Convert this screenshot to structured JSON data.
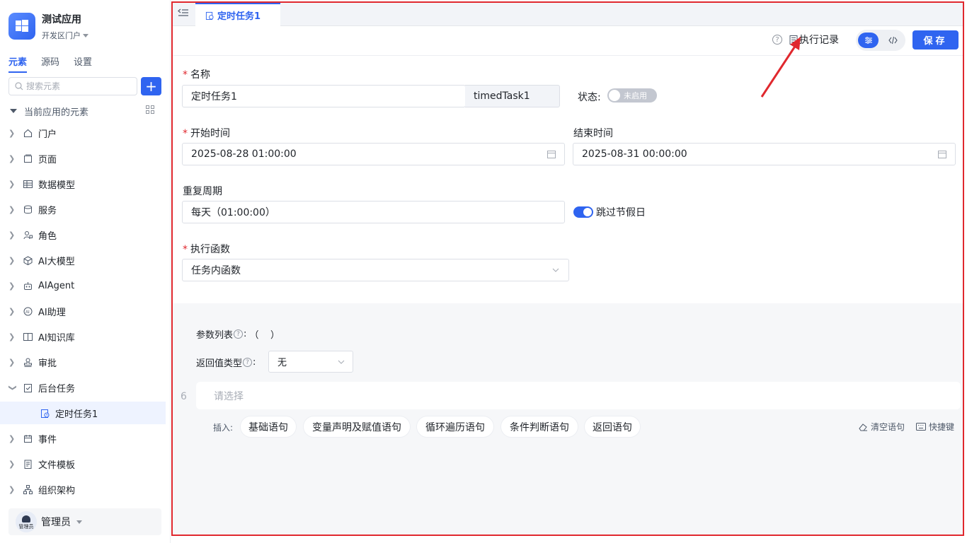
{
  "sidebar": {
    "app_name": "测试应用",
    "portal": "开发区门户",
    "tabs": [
      {
        "label": "元素",
        "active": true
      },
      {
        "label": "源码",
        "active": false
      },
      {
        "label": "设置",
        "active": false
      }
    ],
    "search_placeholder": "搜索元素",
    "add_label": "+",
    "tree_root": "当前应用的元素",
    "items": [
      {
        "label": "门户",
        "icon": "home-icon"
      },
      {
        "label": "页面",
        "icon": "page-icon"
      },
      {
        "label": "数据模型",
        "icon": "table-icon"
      },
      {
        "label": "服务",
        "icon": "database-icon"
      },
      {
        "label": "角色",
        "icon": "role-icon"
      },
      {
        "label": "AI大模型",
        "icon": "cube-icon"
      },
      {
        "label": "AIAgent",
        "icon": "robot-icon"
      },
      {
        "label": "AI助理",
        "icon": "ai-assistant-icon"
      },
      {
        "label": "AI知识库",
        "icon": "book-icon"
      },
      {
        "label": "审批",
        "icon": "stamp-icon"
      },
      {
        "label": "后台任务",
        "icon": "task-icon"
      },
      {
        "label": "定时任务1",
        "icon": "timed-task-icon"
      },
      {
        "label": "事件",
        "icon": "event-icon"
      },
      {
        "label": "文件模板",
        "icon": "file-template-icon"
      },
      {
        "label": "组织架构",
        "icon": "org-chart-icon"
      }
    ],
    "user": {
      "name": "管理员",
      "avatar_text": "管理员"
    }
  },
  "tabbar": {
    "tab_label": "定时任务1"
  },
  "toolbar": {
    "help": "?",
    "exec_record": "执行记录",
    "save_label": "保存"
  },
  "form": {
    "name_label": "名称",
    "name_value": "定时任务1",
    "name_code": "timedTask1",
    "status_label": "状态:",
    "status_toggle_text": "未启用",
    "start_label": "开始时间",
    "start_value": "2025-08-28 01:00:00",
    "end_label": "结束时间",
    "end_value": "2025-08-31 00:00:00",
    "repeat_label": "重复周期",
    "repeat_value": "每天（01:00:00）",
    "skip_holiday_label": "跳过节假日",
    "func_label": "执行函数",
    "func_value": "任务内函数"
  },
  "function": {
    "params_label": "参数列表",
    "params_value": "（    ）",
    "return_label": "返回值类型",
    "return_value": "无",
    "line_number": "6",
    "stmt_placeholder": "请选择",
    "insert_label": "插入:",
    "chips": [
      "基础语句",
      "变量声明及赋值语句",
      "循环遍历语句",
      "条件判断语句",
      "返回语句"
    ],
    "clear_label": "清空语句",
    "shortcut_label": "快捷键"
  },
  "colors": {
    "accent": "#2f64f0",
    "annotation": "#e0282e"
  }
}
